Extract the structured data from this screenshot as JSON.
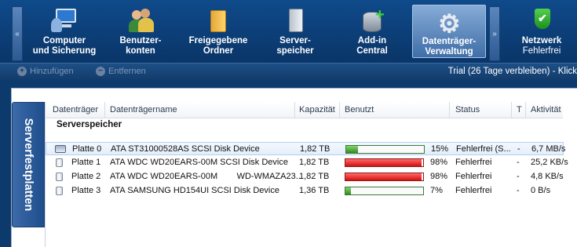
{
  "nav": {
    "scroll_left": "«",
    "scroll_right": "»",
    "items": [
      {
        "line1": "Computer",
        "line2": "und Sicherung",
        "icon": "computer-backup-icon"
      },
      {
        "line1": "Benutzer-",
        "line2": "konten",
        "icon": "users-icon"
      },
      {
        "line1": "Freigegebene",
        "line2": "Ordner",
        "icon": "folder-icon"
      },
      {
        "line1": "Server-",
        "line2": "speicher",
        "icon": "server-icon"
      },
      {
        "line1": "Add-in",
        "line2": "Central",
        "icon": "addin-icon"
      },
      {
        "line1": "Datenträger-",
        "line2": "Verwaltung",
        "icon": "gear-icon",
        "active": true
      },
      {
        "line1": "Netzwerk",
        "line2": "Fehlerfrei",
        "icon": "shield-check-icon"
      }
    ]
  },
  "toolbar": {
    "add_label": "Hinzufügen",
    "remove_label": "Entfernen",
    "trial_text": "Trial (26 Tage verbleiben) - Klick"
  },
  "side_tab": "Serverfestplatten",
  "table": {
    "headers": [
      "Datenträger",
      "Datenträgername",
      "Kapazität",
      "Benutzt",
      "Status",
      "T",
      "Aktivität"
    ],
    "group": "Serverspeicher",
    "rows": [
      {
        "disk": "Platte 0",
        "name": "ATA ST31000528AS SCSI Disk Device",
        "capacity": "1,82 TB",
        "used_pct": 15,
        "used_label": "15%",
        "status": "Fehlerfrei (S...",
        "t": "-",
        "activity": "6,7 MB/s",
        "selected": true
      },
      {
        "disk": "Platte 1",
        "name": "ATA WDC WD20EARS-00M SCSI Disk Device",
        "capacity": "1,82 TB",
        "used_pct": 98,
        "used_label": "98%",
        "status": "Fehlerfrei",
        "t": "-",
        "activity": "25,2 KB/s"
      },
      {
        "disk": "Platte 2",
        "name": "ATA WDC WD20EARS-00M        WD-WMAZA23...",
        "capacity": "1,82 TB",
        "used_pct": 98,
        "used_label": "98%",
        "status": "Fehlerfrei",
        "t": "-",
        "activity": "4,8 KB/s"
      },
      {
        "disk": "Platte 3",
        "name": "ATA SAMSUNG HD154UI SCSI Disk Device",
        "capacity": "1,36 TB",
        "used_pct": 7,
        "used_label": "7%",
        "status": "Fehlerfrei",
        "t": "-",
        "activity": "0 B/s"
      }
    ]
  },
  "colors": {
    "ok_bar": "#2e8c22",
    "critical_bar": "#d31010",
    "accent": "#0f4a8a"
  }
}
